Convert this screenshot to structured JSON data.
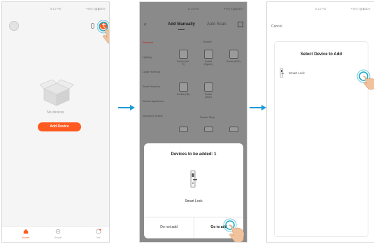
{
  "screen1": {
    "status_time": "8:14 PM",
    "status_icons": "✦ ✉ ◎ ◑ ▥ ▮ 100%",
    "empty_text": "No devices",
    "add_button": "Add Device",
    "tabs": [
      {
        "label": "Home",
        "icon": "home-icon",
        "active": true
      },
      {
        "label": "Smart",
        "icon": "smart-icon",
        "active": false
      },
      {
        "label": "Me",
        "icon": "me-icon",
        "active": false
      }
    ]
  },
  "screen2": {
    "status_time": "8:14 PM",
    "status_icons": "✦ ✉ ◎ ◑ ▥ ▮ 100%",
    "tabs": [
      {
        "label": "Add Manually"
      },
      {
        "label": "Auto Scan"
      }
    ],
    "sidebar": [
      "Electrical",
      "Lighting",
      "Large Home Ap.",
      "Small Home Ap.",
      "Kitchen Appliances",
      "Security & Sensor"
    ],
    "section1": "Socket",
    "section2": "Power Strip",
    "grid": [
      "Socket (Wi-Fi)",
      "Socket (Zigbee)",
      "Socket (BLE)",
      "Socket (NB)",
      "Socket (other)"
    ],
    "sheet": {
      "title": "Devices to be added: 1",
      "device": "Smart Lock",
      "cancel": "Do not add",
      "confirm": "Go to add"
    }
  },
  "screen3": {
    "status_time": "8:14 PM",
    "status_icons": "✦ ✉ ◎ ◑ ▥ ▮ 100%",
    "cancel": "Cancel",
    "title": "Select Device to Add",
    "device": "Smart Lock"
  },
  "colors": {
    "accent": "#ff5a1f",
    "arrow": "#1e9ad6",
    "touch_ring": "#19a8c7"
  }
}
